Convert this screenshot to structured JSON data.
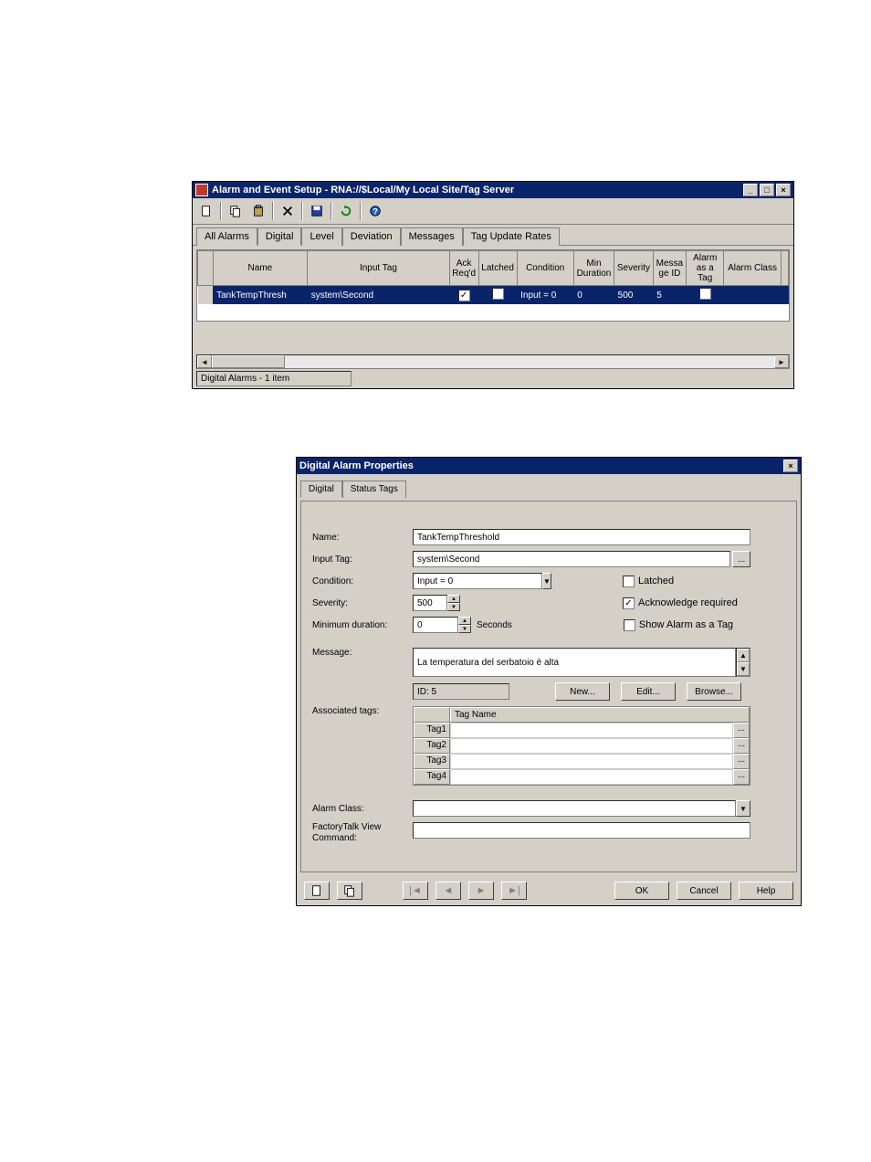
{
  "win1": {
    "title": "Alarm and Event Setup - RNA://$Local/My Local Site/Tag Server",
    "tabs": [
      "All Alarms",
      "Digital",
      "Level",
      "Deviation",
      "Messages",
      "Tag Update Rates"
    ],
    "headers": [
      "Name",
      "Input Tag",
      "Ack Req'd",
      "Latched",
      "Condition",
      "Min Duration",
      "Severity",
      "Messa ge ID",
      "Alarm as a Tag",
      "Alarm Class"
    ],
    "row": {
      "name": "TankTempThresh",
      "inputTag": "system\\Second",
      "condition": "Input = 0",
      "minDuration": "0",
      "severity": "500",
      "messageId": "5"
    },
    "status": "Digital Alarms - 1 item"
  },
  "win2": {
    "title": "Digital Alarm Properties",
    "tabs": [
      "Digital",
      "Status Tags"
    ],
    "labels": {
      "name": "Name:",
      "inputTag": "Input Tag:",
      "condition": "Condition:",
      "severity": "Severity:",
      "minDur": "Minimum duration:",
      "seconds": "Seconds",
      "message": "Message:",
      "assocTags": "Associated tags:",
      "alarmClass": "Alarm Class:",
      "ftCmd": "FactoryTalk View Command:",
      "latched": "Latched",
      "ackReq": "Acknowledge required",
      "showTag": "Show Alarm as a Tag",
      "tagName": "Tag Name"
    },
    "values": {
      "name": "TankTempThreshold",
      "inputTag": "system\\Second",
      "condition": "Input = 0",
      "severity": "500",
      "minDur": "0",
      "message": "La temperatura del serbatoio è alta",
      "messageId": "ID: 5"
    },
    "tags": [
      "Tag1",
      "Tag2",
      "Tag3",
      "Tag4"
    ],
    "buttons": {
      "new": "New...",
      "edit": "Edit...",
      "browse": "Browse...",
      "ok": "OK",
      "cancel": "Cancel",
      "help": "Help",
      "ellipsis": "..."
    }
  }
}
